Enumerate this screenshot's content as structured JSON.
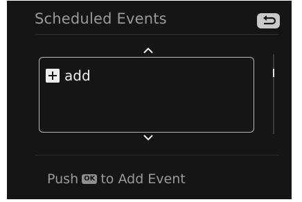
{
  "header": {
    "title": "Scheduled Events",
    "back_icon": "return-arrow-icon"
  },
  "list": {
    "items": [
      {
        "icon": "plus-icon",
        "label": "add"
      }
    ],
    "scroll_up_icon": "chevron-up-icon",
    "scroll_down_icon": "chevron-down-icon"
  },
  "footer": {
    "prefix": "Push",
    "button_label": "OK",
    "suffix": "to Add Event"
  }
}
